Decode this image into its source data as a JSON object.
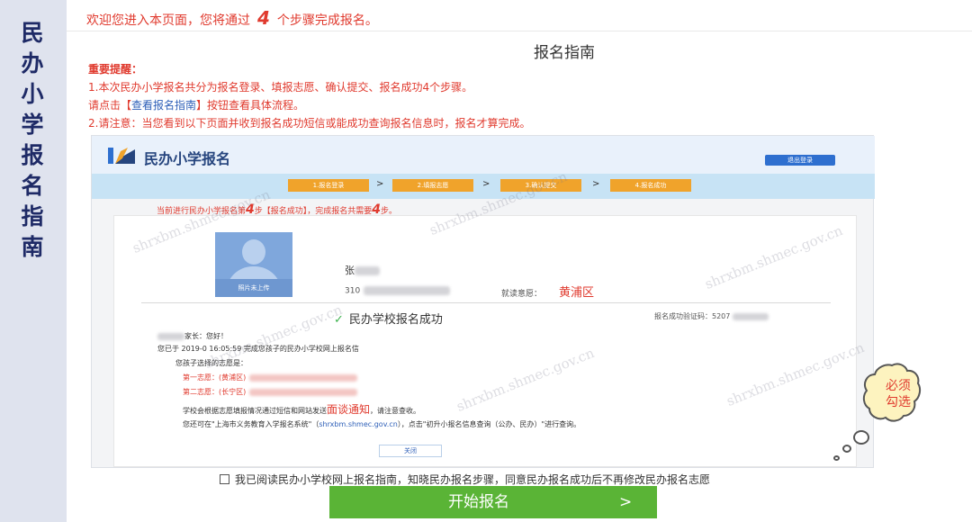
{
  "sidebar": {
    "title": "民办小学报名指南"
  },
  "header": {
    "welcome_prefix": "欢迎您进入本页面，您将通过",
    "welcome_steps": "4",
    "welcome_suffix": "个步骤完成报名。",
    "title": "报名指南"
  },
  "notice": {
    "heading": "重要提醒：",
    "line1": "1.本次民办小学报名共分为报名登录、填报志愿、确认提交、报名成功4个步骤。",
    "line2_prefix": "请点击【",
    "line2_link": "查看报名指南",
    "line2_suffix": "】按钮查看具体流程。",
    "line3": "2.请注意：当您看到以下页面并收到报名成功短信或能成功查询报名信息时，报名才算完成。"
  },
  "screenshot": {
    "logo_text": "民办小学报名",
    "logout_label": "退出登录",
    "steps": [
      "1.报名登录",
      "2.填报志愿",
      "3.确认提交",
      "4.报名成功"
    ],
    "step_arrow": ">",
    "progress_prefix": "当前进行民办小学报名第",
    "progress_current": "4",
    "progress_middle": "步【报名成功】，完成报名共需要",
    "progress_total": "4",
    "progress_suffix": "步。",
    "avatar_caption": "照片未上传",
    "name_visible": "张",
    "id_visible": "310",
    "district_label": "就读意愿：",
    "district_value": "黄浦区",
    "success_text": "民办学校报名成功",
    "serial_label": "报名成功验证码：5207",
    "greeting": "家长：您好！",
    "message1": "您已于 2019-0    16:05:59 完成您孩子的民办小学校网上报名信",
    "message2": "您孩子选择的志愿是：",
    "choice1": "第一志愿：(黄浦区)",
    "choice2": "第二志愿：(长宁区)",
    "message3_prefix": "学校会根据志愿填报情况通过短信和网站发送",
    "message3_highlight": "面谈通知",
    "message3_suffix": "，请注意查收。",
    "message4_prefix": "您还可在\"上海市义务教育入学报名系统\"（",
    "message4_link": "shrxbm.shmec.gov.cn",
    "message4_suffix": "），点击\"初升小报名信息查询（公办、民办）\"进行查询。",
    "close_label": "关闭",
    "watermark": "shrxbm.shmec.gov.cn"
  },
  "callout": {
    "text": "必须勾选"
  },
  "agreement": {
    "text": "我已阅读民办小学校网上报名指南，知晓民办报名步骤，同意民办报名成功后不再修改民办报名志愿"
  },
  "start_button": {
    "label": "开始报名",
    "chevron": ">"
  },
  "colors": {
    "accent_red": "#e03a2e",
    "step_orange": "#f0a32b",
    "button_green": "#5ab436",
    "link_blue": "#2f60b8"
  }
}
